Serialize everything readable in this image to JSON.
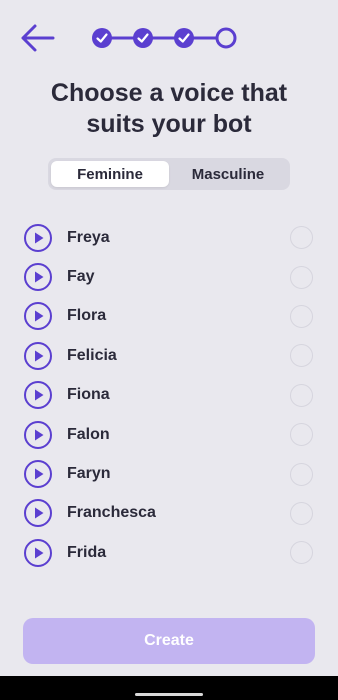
{
  "header": {
    "back_icon": "arrow-left-icon",
    "steps": [
      "done",
      "done",
      "done",
      "current"
    ],
    "accent": "#5b3fd0"
  },
  "title": {
    "line1": "Choose a voice that",
    "line2": "suits your bot"
  },
  "tabs": [
    {
      "label": "Feminine",
      "selected": true
    },
    {
      "label": "Masculine",
      "selected": false
    }
  ],
  "voices": [
    {
      "name": "Freya"
    },
    {
      "name": "Fay"
    },
    {
      "name": "Flora"
    },
    {
      "name": "Felicia"
    },
    {
      "name": "Fiona"
    },
    {
      "name": "Falon"
    },
    {
      "name": "Faryn"
    },
    {
      "name": "Franchesca"
    },
    {
      "name": "Frida"
    }
  ],
  "create_button": {
    "label": "Create",
    "color": "#c2b4f1"
  }
}
